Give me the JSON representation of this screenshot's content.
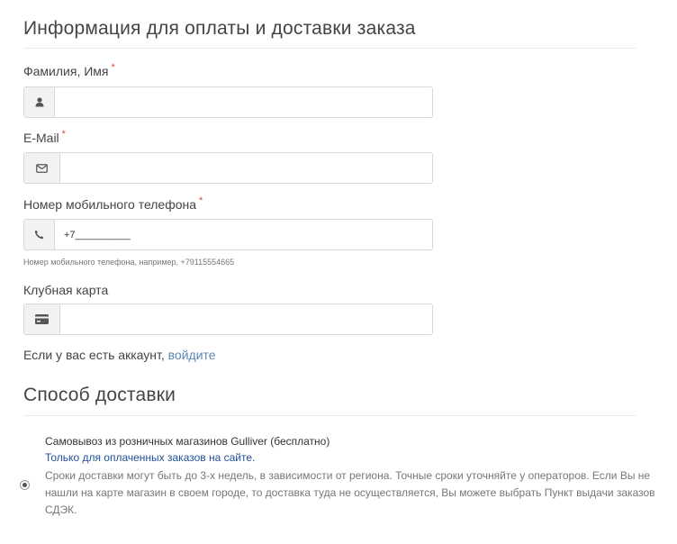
{
  "payment": {
    "title": "Информация для оплаты и доставки заказа",
    "fields": {
      "name": {
        "label": "Фамилия, Имя",
        "required_mark": "*",
        "value": "",
        "icon": "user-icon"
      },
      "email": {
        "label": "E-Mail",
        "required_mark": "*",
        "value": "",
        "icon": "envelope-icon"
      },
      "phone": {
        "label": "Номер мобильного телефона",
        "required_mark": "*",
        "value": "+7__________",
        "icon": "phone-icon",
        "help": "Номер мобильного телефона, например, +79115554665"
      },
      "club_card": {
        "label": "Клубная карта",
        "value": "",
        "icon": "credit-card-icon"
      }
    },
    "login_prompt": "Если у вас есть аккаунт,",
    "login_link": "войдите"
  },
  "delivery": {
    "title": "Способ доставки",
    "options": [
      {
        "title": "Самовывоз из розничных магазинов Gulliver (бесплатно)",
        "note": "Только для оплаченных заказов на сайте.",
        "description": "Сроки доставки могут быть до 3-х недель, в зависимости от региона. Точные сроки уточняйте у операторов. Если Вы не нашли на карте магазин в своем городе, то доставка туда не осуществляется, Вы можете выбрать Пункт выдачи заказов СДЭК.",
        "selected": true
      }
    ]
  },
  "colors": {
    "required": "#e0453a",
    "link": "#5b87b6",
    "note": "#1f4f9a",
    "border": "#d9d9d9",
    "addon_bg": "#f2f2f2"
  }
}
